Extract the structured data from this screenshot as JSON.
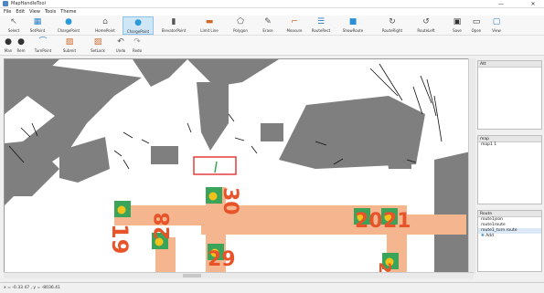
{
  "window": {
    "title": "MapHandleTool",
    "minimize": "—",
    "close": "✕"
  },
  "menu": [
    "File",
    "Edit",
    "View",
    "Tools",
    "Theme"
  ],
  "toolbar_main": [
    {
      "label": "Select",
      "icon": "select-icon",
      "glyph": "↖",
      "color": "#6a6a6a",
      "active": false
    },
    {
      "label": "SetPoint",
      "icon": "set-point-icon",
      "glyph": "▦",
      "color": "#2a7fc9",
      "active": false
    },
    {
      "label": "ChargePoint",
      "icon": "charge-point-icon",
      "glyph": "●",
      "color": "#2a9ad6",
      "active": false
    },
    {
      "label": "HomePoint",
      "icon": "home-point-icon",
      "glyph": "⌂",
      "color": "#6a6a6a",
      "active": false
    },
    {
      "label": "ChargePoint",
      "icon": "charge-point-icon",
      "glyph": "●",
      "color": "#2a9ad6",
      "active": true
    },
    {
      "label": "ElevatorPoint",
      "icon": "elevator-point-icon",
      "glyph": "▮",
      "color": "#555555",
      "active": false
    },
    {
      "label": "Limit Line",
      "icon": "limit-line-icon",
      "glyph": "▬",
      "color": "#d06a2a",
      "active": false
    },
    {
      "label": "Polygon",
      "icon": "polygon-icon",
      "glyph": "⬠",
      "color": "#555555",
      "active": false
    },
    {
      "label": "Erase",
      "icon": "erase-icon",
      "glyph": "✎",
      "color": "#555555",
      "active": false
    },
    {
      "label": "Measure",
      "icon": "measure-icon",
      "glyph": "⌐",
      "color": "#d06a2a",
      "active": false
    },
    {
      "label": "RouteRect",
      "icon": "route-rect-icon",
      "glyph": "☰",
      "color": "#2a7fc9",
      "active": false
    },
    {
      "label": "ShowRoute",
      "icon": "show-route-icon",
      "glyph": "■",
      "color": "#2a8fd6",
      "active": false
    },
    {
      "label": "RouteRight",
      "icon": "route-right-icon",
      "glyph": "↻",
      "color": "#555555",
      "active": false
    },
    {
      "label": "RouteLeft",
      "icon": "route-left-icon",
      "glyph": "↺",
      "color": "#555555",
      "active": false
    },
    {
      "label": "Save",
      "icon": "save-icon",
      "glyph": "▣",
      "color": "#333333",
      "active": false
    },
    {
      "label": "Open",
      "icon": "open-icon",
      "glyph": "▭",
      "color": "#333333",
      "active": false
    },
    {
      "label": "View",
      "icon": "view-icon",
      "glyph": "▢",
      "color": "#2a7fc9",
      "active": false
    }
  ],
  "toolbar_secondary": [
    {
      "label": "Man",
      "icon": "man-icon",
      "glyph": "●",
      "color": "#333333"
    },
    {
      "label": "Rem",
      "icon": "rem-icon",
      "glyph": "●",
      "color": "#333333"
    },
    {
      "label": "TurnPoint",
      "icon": "turn-point-icon",
      "glyph": "⌒",
      "color": "#2a7fc9"
    },
    {
      "label": "Submit",
      "icon": "submit-icon",
      "glyph": "▨",
      "color": "#d06a2a"
    },
    {
      "label": "SetLock",
      "icon": "set-lock-icon",
      "glyph": "▨",
      "color": "#d06a2a"
    },
    {
      "label": "Undo",
      "icon": "undo-icon",
      "glyph": "↶",
      "color": "#555555"
    },
    {
      "label": "Redo",
      "icon": "redo-icon",
      "glyph": "↷",
      "color": "#9a9a9a"
    }
  ],
  "map": {
    "stations": [
      {
        "label": "19"
      },
      {
        "label": "20"
      },
      {
        "label": "21"
      },
      {
        "label": "28"
      },
      {
        "label": "29"
      },
      {
        "label": "30"
      },
      {
        "label": "2"
      }
    ],
    "colors": {
      "route": "#f4b58f",
      "station": "#3aa55a",
      "point": "#f2c21b",
      "label": "#e8542a",
      "highlight": "#e02020"
    }
  },
  "panels": {
    "attr": {
      "header": "Att"
    },
    "map": {
      "header": "map",
      "items": [
        "map1 1"
      ]
    },
    "route": {
      "header": "Route",
      "items": [
        "route1json",
        "route1route",
        "route1_turn.route",
        "Add"
      ]
    }
  },
  "status": {
    "text": "x = -0.33  47 ,  y = -8036.41"
  }
}
